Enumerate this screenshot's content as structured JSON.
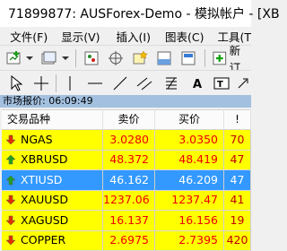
{
  "window": {
    "title": "71899877: AUSForex-Demo - 模拟帐户 - [XB"
  },
  "menu": [
    "文件(F)",
    "显示(V)",
    "插入(I)",
    "图表(C)",
    "工具(T"
  ],
  "toolbar": {
    "new_order_label": "新订"
  },
  "market_watch": {
    "header": "市场报价: 06:09:49",
    "columns": [
      "交易品种",
      "卖价",
      "买价",
      "!"
    ],
    "rows": [
      {
        "symbol": "NGAS",
        "bid": "3.0280",
        "ask": "3.0350",
        "spread": "70",
        "direction": "down",
        "state": "yellow"
      },
      {
        "symbol": "XBRUSD",
        "bid": "48.372",
        "ask": "48.419",
        "spread": "47",
        "direction": "up",
        "state": "yellow"
      },
      {
        "symbol": "XTIUSD",
        "bid": "46.162",
        "ask": "46.209",
        "spread": "47",
        "direction": "up",
        "state": "selected"
      },
      {
        "symbol": "XAUUSD",
        "bid": "1237.06",
        "ask": "1237.47",
        "spread": "41",
        "direction": "down",
        "state": "yellow"
      },
      {
        "symbol": "XAGUSD",
        "bid": "16.137",
        "ask": "16.156",
        "spread": "19",
        "direction": "down",
        "state": "yellow"
      },
      {
        "symbol": "COPPER",
        "bid": "2.6975",
        "ask": "2.7395",
        "spread": "420",
        "direction": "down",
        "state": "yellow"
      }
    ]
  },
  "colors": {
    "up": "#22a022",
    "down": "#e03000",
    "highlight": "#ffff00",
    "selected": "#3399ff"
  }
}
